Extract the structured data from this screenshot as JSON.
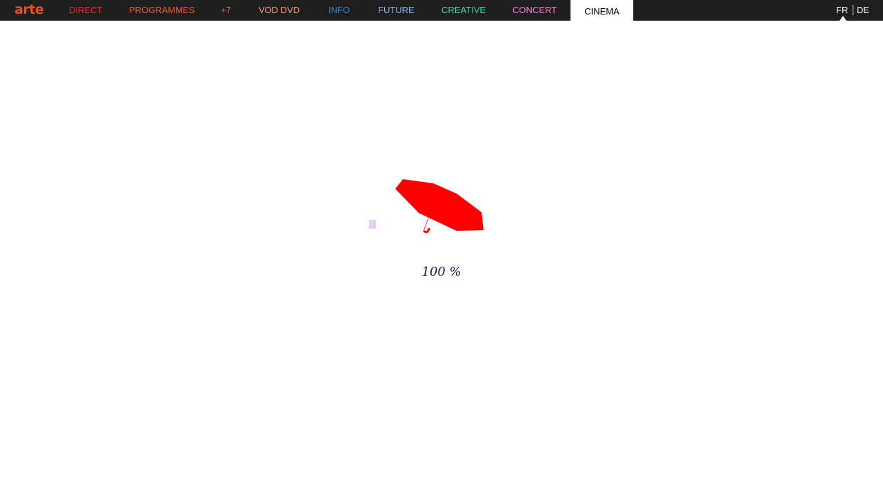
{
  "header": {
    "logo": "arte",
    "nav": [
      {
        "label": "DIRECT",
        "color": "#e2312b"
      },
      {
        "label": "PROGRAMMES",
        "color": "#f0583a"
      },
      {
        "label": "+7",
        "color": "#f36d3c"
      },
      {
        "label": "VOD DVD",
        "color": "#f5a27a"
      },
      {
        "label": "INFO",
        "color": "#2f8ad9"
      },
      {
        "label": "FUTURE",
        "color": "#8bb5ff"
      },
      {
        "label": "CREATIVE",
        "color": "#3fd6a2"
      },
      {
        "label": "CONCERT",
        "color": "#f07ad8"
      },
      {
        "label": "CINEMA",
        "color": "#000000",
        "active": true
      }
    ],
    "languages": [
      "FR",
      "DE"
    ],
    "active_language": "FR"
  },
  "loader": {
    "icon": "umbrella-icon",
    "progress_percent": 100,
    "progress_label": "100 %",
    "umbrella_color": "#ff0000",
    "square_color": "#e4d0f6"
  }
}
